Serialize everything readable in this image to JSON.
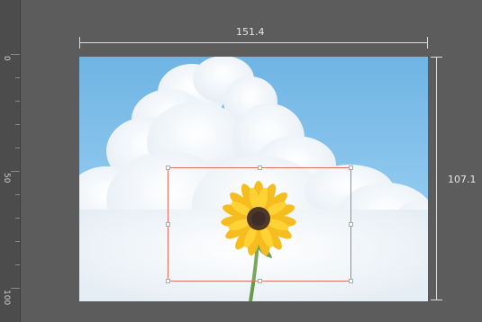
{
  "ruler": {
    "labels": [
      "0",
      "50",
      "100"
    ]
  },
  "dimensions": {
    "width_label": "151.4",
    "height_label": "107.1"
  },
  "image": {
    "subject": "sunflower-against-cloudy-sky"
  },
  "colors": {
    "crop_border": "#e07060",
    "sky": "#6fb4e4",
    "canvas_bg": "#5c5c5c"
  }
}
